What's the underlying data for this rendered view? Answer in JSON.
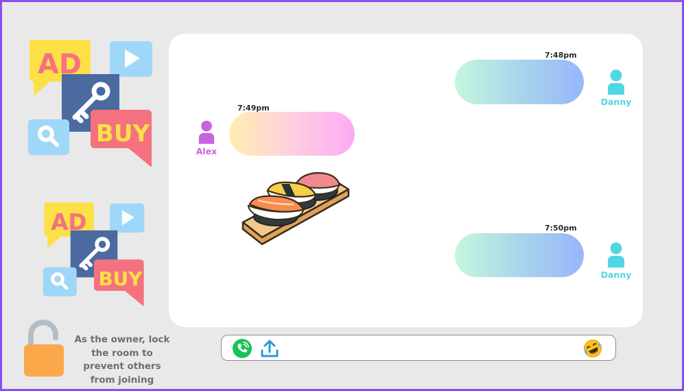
{
  "chat": {
    "messages": [
      {
        "sender": "Danny",
        "time": "7:48pm",
        "direction": "outgoing"
      },
      {
        "sender": "Alex",
        "time": "7:49pm",
        "direction": "incoming"
      },
      {
        "sender": "Danny",
        "time": "7:50pm",
        "direction": "outgoing"
      }
    ],
    "sticker": "sushi"
  },
  "ads": [
    {
      "ad_text": "AD",
      "buy_text": "BUY"
    },
    {
      "ad_text": "AD",
      "buy_text": "BUY"
    }
  ],
  "lock": {
    "note": "As the owner, lock the room to prevent others from joining",
    "icon": "unlocked-padlock-icon",
    "color": "#fba84a"
  },
  "composer": {
    "icons": [
      "phone-call-icon",
      "upload-icon",
      "laughing-emoji-icon"
    ]
  },
  "colors": {
    "frame_border": "#8b4cf0",
    "background": "#e9e9e9",
    "danny_name": "#4fd7e4",
    "alex_name": "#c763e0"
  }
}
